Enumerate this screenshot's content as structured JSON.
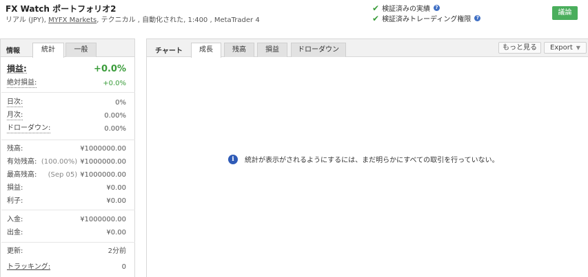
{
  "header": {
    "title": "FX Watch ポートフォリオ2",
    "subtitle_prefix": "リアル (JPY), ",
    "broker_link": "MYFX Markets",
    "subtitle_suffix": ", テクニカル , 自動化された, 1:400 , MetaTrader 4",
    "verified_track_record": "検証済みの実績",
    "verified_trading_privileges": "検証済みトレーディング権限",
    "discuss_button": "議論"
  },
  "left_panel": {
    "heading": "情報",
    "tabs": [
      {
        "label": "統計",
        "active": true
      },
      {
        "label": "一般",
        "active": false
      }
    ],
    "stats": {
      "gain": {
        "label": "損益:",
        "value": "+0.0%"
      },
      "abs_gain": {
        "label": "絶対損益:",
        "value": "+0.0%"
      },
      "daily": {
        "label": "日次:",
        "value": "0%"
      },
      "monthly": {
        "label": "月次:",
        "value": "0.00%"
      },
      "drawdown": {
        "label": "ドローダウン:",
        "value": "0.00%"
      },
      "balance": {
        "label": "残高:",
        "value": "¥1000000.00"
      },
      "equity": {
        "label": "有効残高:",
        "note": "(100.00%)",
        "value": "¥1000000.00"
      },
      "highest": {
        "label": "最高残高:",
        "note": "(Sep 05)",
        "value": "¥1000000.00"
      },
      "profit": {
        "label": "損益:",
        "value": "¥0.00"
      },
      "interest": {
        "label": "利子:",
        "value": "¥0.00"
      },
      "deposits": {
        "label": "入金:",
        "value": "¥1000000.00"
      },
      "withdrawals": {
        "label": "出金:",
        "value": "¥0.00"
      },
      "updated": {
        "label": "更新:",
        "value": "2分前"
      },
      "tracking": {
        "label": "トラッキング:",
        "value": "0"
      }
    }
  },
  "right_panel": {
    "heading": "チャート",
    "tabs": [
      {
        "label": "成長",
        "active": true
      },
      {
        "label": "残高",
        "active": false
      },
      {
        "label": "損益",
        "active": false
      },
      {
        "label": "ドローダウン",
        "active": false
      }
    ],
    "more_button": "もっと見る",
    "export_button": "Export",
    "empty_message": "統計が表示がされるようにするには、まだ明らかにすべての取引を行っていない。"
  },
  "colors": {
    "accent_green": "#3a9c3a",
    "discuss_button": "#4aae5c",
    "info_blue": "#2f5bb7"
  }
}
